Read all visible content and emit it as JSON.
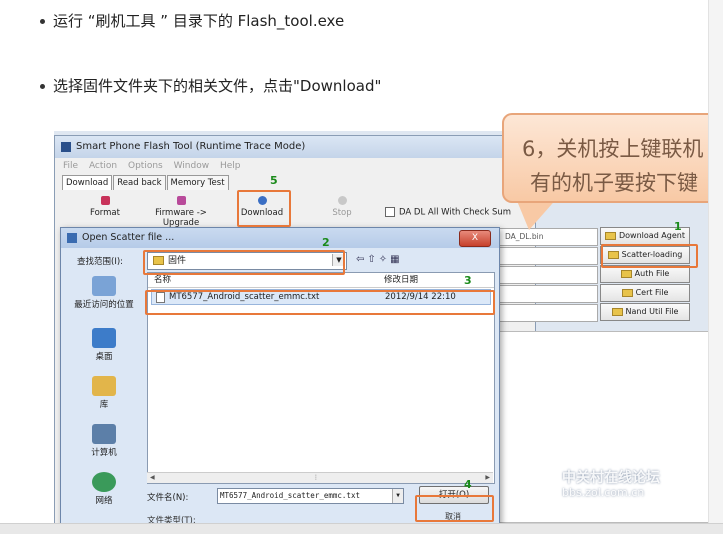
{
  "bullets": [
    "运行 “刷机工具 ” 目录下的 Flash_tool.exe",
    "选择固件文件夹下的相关文件，点击\"Download\""
  ],
  "app": {
    "title": "Smart Phone Flash Tool (Runtime Trace Mode)",
    "menu": [
      "File",
      "Action",
      "Options",
      "Window",
      "Help"
    ],
    "tabs": [
      "Download",
      "Read back",
      "Memory Test"
    ],
    "toolbar": {
      "format": "Format",
      "firmware_upgrade": "Firmware -> Upgrade",
      "download": "Download",
      "stop": "Stop",
      "da_dl_checksum": "DA DL All With Check Sum"
    },
    "da_field": "DA_DL.bin",
    "right_buttons": [
      "Download Agent",
      "Scatter-loading",
      "Auth File",
      "Cert File",
      "Nand Util File"
    ]
  },
  "dialog": {
    "title": "Open Scatter file ...",
    "close": "X",
    "look_in_label": "查找范围(I):",
    "look_in_value": "固件",
    "places": [
      "最近访问的位置",
      "桌面",
      "库",
      "计算机",
      "网络"
    ],
    "columns": {
      "name": "名称",
      "modified": "修改日期"
    },
    "files": [
      {
        "name": "MT6577_Android_scatter_emmc.txt",
        "modified": "2012/9/14 22:10"
      }
    ],
    "filename_label": "文件名(N):",
    "filename_value": "MT6577_Android_scatter_emmc.txt",
    "filetype_label": "文件类型(T):",
    "open_button": "打开(O)",
    "cancel_button": "取消"
  },
  "steps": [
    "1",
    "2",
    "3",
    "4",
    "5"
  ],
  "callout": {
    "line1": "6，关机按上键联机",
    "line2": "有的机子要按下键"
  },
  "watermark": {
    "text": "中关村在线论坛",
    "url": "bbs.zol.com.cn"
  },
  "colors": {
    "highlight": "#e8783a",
    "step_number": "#1a8a1a",
    "callout_fill": "#f8c9a5"
  }
}
